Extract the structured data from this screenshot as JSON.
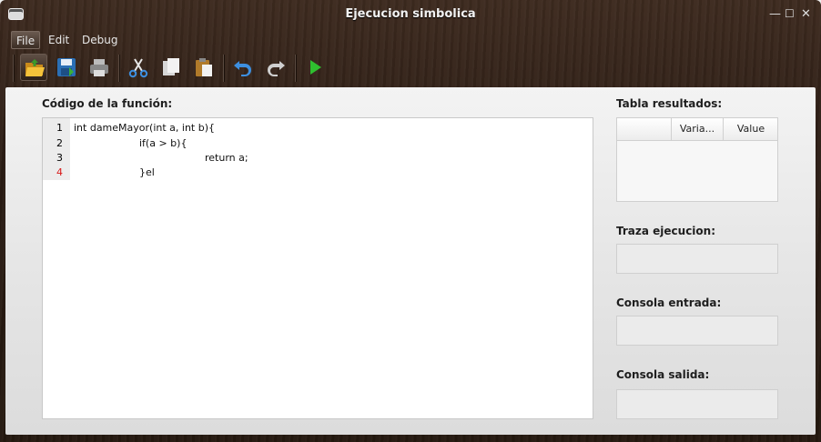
{
  "window": {
    "title": "Ejecucion simbolica",
    "controls": {
      "minimize": "—",
      "maximize": "☐",
      "close": "✕"
    }
  },
  "menu": [
    {
      "label": "File"
    },
    {
      "label": "Edit"
    },
    {
      "label": "Debug"
    }
  ],
  "toolbar": {
    "buttons": [
      "open-icon",
      "save-icon",
      "print-icon",
      "cut-icon",
      "copy-icon",
      "paste-icon",
      "undo-icon",
      "redo-icon",
      "run-icon"
    ]
  },
  "editor": {
    "label": "Código de la función:",
    "line_numbers": [
      "1",
      "2",
      "3",
      "4"
    ],
    "lines": [
      "int dameMayor(int a, int b){",
      "if(a > b){",
      "return a;",
      "}el"
    ]
  },
  "results": {
    "label": "Tabla resultados:",
    "columns": [
      "",
      "Varia...",
      "Value"
    ]
  },
  "trace": {
    "label": "Traza ejecucion:"
  },
  "input_console": {
    "label": "Consola entrada:"
  },
  "output_console": {
    "label": "Consola salida:"
  },
  "colors": {
    "accent_run": "#2fbf2f",
    "error_line": "#d81818"
  }
}
